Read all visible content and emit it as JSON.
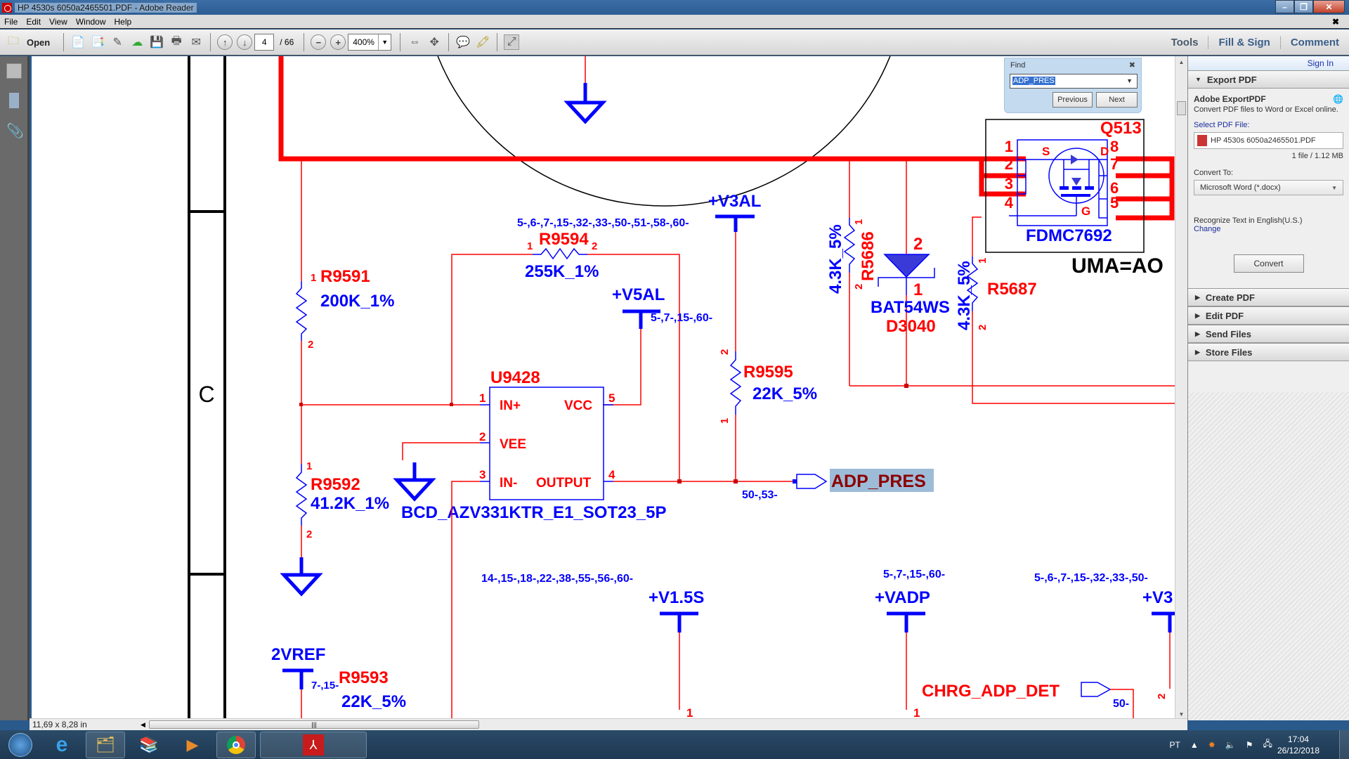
{
  "window": {
    "title": "HP 4530s 6050a2465501.PDF - Adobe Reader"
  },
  "menu": [
    "File",
    "Edit",
    "View",
    "Window",
    "Help"
  ],
  "toolbar": {
    "open_label": "Open",
    "page_current": "4",
    "page_total": "/ 66",
    "zoom_level": "400%",
    "right_tabs": [
      "Tools",
      "Fill & Sign",
      "Comment"
    ]
  },
  "find": {
    "label": "Find",
    "query": "ADP_PRES",
    "previous_label": "Previous",
    "next_label": "Next"
  },
  "right_panel": {
    "sign_in": "Sign In",
    "export_header": "Export PDF",
    "export_title": "Adobe ExportPDF",
    "export_desc": "Convert PDF files to Word or Excel online.",
    "select_label": "Select PDF File:",
    "file_name": "HP 4530s 6050a2465501.PDF",
    "file_info": "1 file / 1.12 MB",
    "convert_to_label": "Convert To:",
    "convert_to_value": "Microsoft Word (*.docx)",
    "recognize_text": "Recognize Text in English(U.S.)",
    "change_link": "Change",
    "convert_button": "Convert",
    "sections": [
      "Create PDF",
      "Edit PDF",
      "Send Files",
      "Store Files"
    ]
  },
  "status": {
    "page_size": "11,69 x 8,28 in"
  },
  "schematic": {
    "border_zone": "C",
    "r9591": {
      "ref": "R9591",
      "value": "200K_1%",
      "pin1": "1",
      "pin2": "2"
    },
    "r9592": {
      "ref": "R9592",
      "value": "41.2K_1%",
      "pin1": "1",
      "pin2": "2"
    },
    "r9593": {
      "ref": "R9593",
      "value": "22K_5%"
    },
    "r9594": {
      "ref": "R9594",
      "value": "255K_1%",
      "pin1": "1",
      "pin2": "2"
    },
    "r9595": {
      "ref": "R9595",
      "value": "22K_5%",
      "pin1": "1",
      "pin2": "2"
    },
    "r5686": {
      "ref": "R5686",
      "value": "4.3K_5%",
      "pin1": "1",
      "pin2": "2"
    },
    "r5687": {
      "ref": "R5687",
      "value": "4.3K_5%",
      "pin1": "1",
      "pin2": "2"
    },
    "d3040": {
      "ref": "D3040",
      "part": "BAT54WS",
      "pin1": "1",
      "pin2": "2"
    },
    "q513": {
      "ref": "Q513",
      "part": "FDMC7692",
      "pins": [
        "1",
        "2",
        "3",
        "4",
        "8",
        "7",
        "6",
        "5"
      ],
      "s": "S",
      "d": "D",
      "g": "G",
      "option": "UMA=AO"
    },
    "u9428": {
      "ref": "U9428",
      "part": "BCD_AZV331KTR_E1_SOT23_5P",
      "pins": {
        "in_plus": "IN+",
        "vee": "VEE",
        "in_minus": "IN-",
        "vcc": "VCC",
        "output": "OUTPUT"
      },
      "pin_numbers": [
        "1",
        "2",
        "3",
        "5",
        "4"
      ]
    },
    "rails": {
      "v3al": {
        "name": "+V3AL",
        "refs": "5-,6-,7-,15-,32-,33-,50-,51-,58-,60-"
      },
      "v5al": {
        "name": "+V5AL",
        "refs": "5-,7-,15-,60-"
      },
      "v15s": {
        "name": "+V1.5S",
        "refs": "14-,15-,18-,22-,38-,55-,56-,60-"
      },
      "vadp": {
        "name": "+VADP",
        "refs": "5-,7-,15-,60-"
      },
      "v3_right": {
        "name": "+V3",
        "refs": "5-,6-,7-,15-,32-,33-,50-"
      },
      "vref": {
        "name": "2VREF",
        "refs": "7-,15-"
      }
    },
    "nets": {
      "adp_pres": {
        "name": "ADP_PRES",
        "refs": "50-,53-"
      },
      "chrg_adp_det": {
        "name": "CHRG_ADP_DET",
        "refs": "50-"
      }
    },
    "misc_pins": {
      "v15s_pin": "1",
      "vadp_pin": "1",
      "v3_pin": "2"
    }
  },
  "tray": {
    "lang": "PT",
    "time": "17:04",
    "date": "26/12/2018"
  },
  "colors": {
    "wire": "#ff0000",
    "symbol": "#0000ff",
    "ref": "#ff0000",
    "highlight": "#9dbcd8",
    "net_highlight_text": "#8b0000"
  }
}
